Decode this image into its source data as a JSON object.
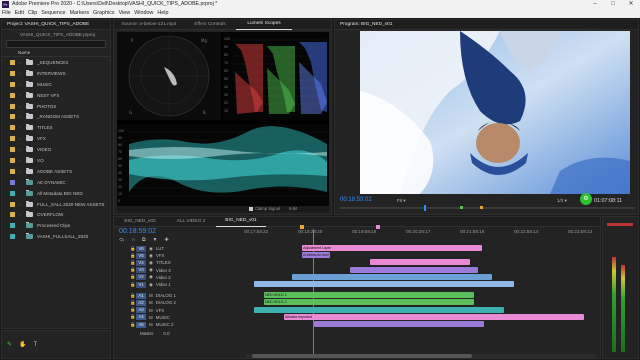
{
  "window": {
    "title": "Adobe Premiere Pro 2020 - C:\\Users\\Dell\\Desktop\\VASHI_QUICK_TIPS_ADOBE.prproj *",
    "app_icon_label": "Pr",
    "controls": [
      "–",
      "□",
      "✕"
    ]
  },
  "menu": [
    "File",
    "Edit",
    "Clip",
    "Sequence",
    "Markers",
    "Graphics",
    "View",
    "Window",
    "Help"
  ],
  "project": {
    "tab": "Project: VASHI_QUICK_TIPS_ADOBE",
    "file": "VASHI_QUICK_TIPS_ADOBE.prproj",
    "column_name": "Name",
    "bins": [
      {
        "name": "_SEQUENCES",
        "swatch": "#d9b24a",
        "type": "folder"
      },
      {
        "name": "INTERVIEWS",
        "swatch": "#d9b24a",
        "type": "folder"
      },
      {
        "name": "MUSIC",
        "swatch": "#d9b24a",
        "type": "folder"
      },
      {
        "name": "NEST VFX",
        "swatch": "#d9b24a",
        "type": "folder"
      },
      {
        "name": "PHOTOS",
        "swatch": "#d9b24a",
        "type": "folder"
      },
      {
        "name": "_RANDOM ASSETS",
        "swatch": "#d9b24a",
        "type": "folder"
      },
      {
        "name": "TITLES",
        "swatch": "#d9b24a",
        "type": "folder"
      },
      {
        "name": "VFX",
        "swatch": "#d9b24a",
        "type": "folder"
      },
      {
        "name": "VIDEO",
        "swatch": "#d9b24a",
        "type": "folder"
      },
      {
        "name": "VO",
        "swatch": "#d9b24a",
        "type": "folder"
      },
      {
        "name": "ADOBE ASSETS",
        "swatch": "#d9b24a",
        "type": "folder"
      },
      {
        "name": "AE DYNAMIC",
        "swatch": "#7a7ad9",
        "type": "seq"
      },
      {
        "name": "All Metadata BIG NED",
        "swatch": "#3fb0b0",
        "type": "seq"
      },
      {
        "name": "FULL_SALL 2020 NEW ASSETS",
        "swatch": "#d9b24a",
        "type": "folder"
      },
      {
        "name": "OVERFLOW",
        "swatch": "#d9b24a",
        "type": "folder"
      },
      {
        "name": "Processed Clips",
        "swatch": "#3fb0b0",
        "type": "seq"
      },
      {
        "name": "VASHI_FULLSALL_2020",
        "swatch": "#3fb0b0",
        "type": "seq"
      }
    ]
  },
  "scopes": {
    "tabs": [
      "Source: a-below-121.mp4",
      "Effect Controls",
      "Lumetri Scopes"
    ],
    "active_tab": 2,
    "clamp_label": "Clamp Signal",
    "bit_label": "8-bit",
    "vectorscope_label": "",
    "rgb_scale": [
      "100",
      "90",
      "80",
      "70",
      "60",
      "50",
      "40",
      "30",
      "20",
      "10"
    ],
    "wave_scale": [
      "100",
      "90",
      "80",
      "70",
      "60",
      "50",
      "40",
      "30",
      "20",
      "10",
      "0"
    ]
  },
  "program": {
    "tab": "Program: BIG_NED_v01",
    "timecode": "00:18:59:02",
    "fit": "Fit",
    "resolution": "1/2",
    "duration": "01:07:08:11"
  },
  "timeline": {
    "tabs": [
      "BIG_NED_v02",
      "ALL VIDEO 2",
      "BIG_NED_v01"
    ],
    "active_tab": 2,
    "timecode": "00:18:59:02",
    "ruler": [
      "00:17:58:22",
      "00:18:28:20",
      "00:19:58:19",
      "00:20:28:17",
      "00:21:58:16",
      "00:22:58:14",
      "00:23:58:12"
    ],
    "video_tracks": [
      {
        "id": "V6",
        "name": "LUT"
      },
      {
        "id": "V5",
        "name": "VFX"
      },
      {
        "id": "V4",
        "name": "TITLES"
      },
      {
        "id": "V3",
        "name": "Video 3"
      },
      {
        "id": "V2",
        "name": "Video 2"
      },
      {
        "id": "V1",
        "name": "Video 1"
      }
    ],
    "audio_tracks": [
      {
        "id": "A1",
        "name": "DIALOG 1"
      },
      {
        "id": "A2",
        "name": "DIALOG 2"
      },
      {
        "id": "A3",
        "name": "VFX"
      },
      {
        "id": "A4",
        "name": "MUSIC"
      },
      {
        "id": "A5",
        "name": "MUSIC 2"
      }
    ],
    "master_label": "Master",
    "master_value": "0.0",
    "clip_labels": {
      "adjustment": "Adjustment Layer",
      "below": "A-below-Ai-mod",
      "ned1": "NED HOLD 1",
      "ned2": "NED HOLD 2",
      "music": "Alibaba Imported"
    }
  },
  "tools": [
    "pen-icon",
    "hand-icon",
    "type-icon"
  ],
  "colors": {
    "accent_blue": "#2f8cff",
    "clip_pink": "#e88ad4",
    "clip_violet": "#9b7ad9",
    "clip_green": "#5cbf5c",
    "clip_teal": "#3fb0b0",
    "highlight_green": "#2fbf2f"
  }
}
